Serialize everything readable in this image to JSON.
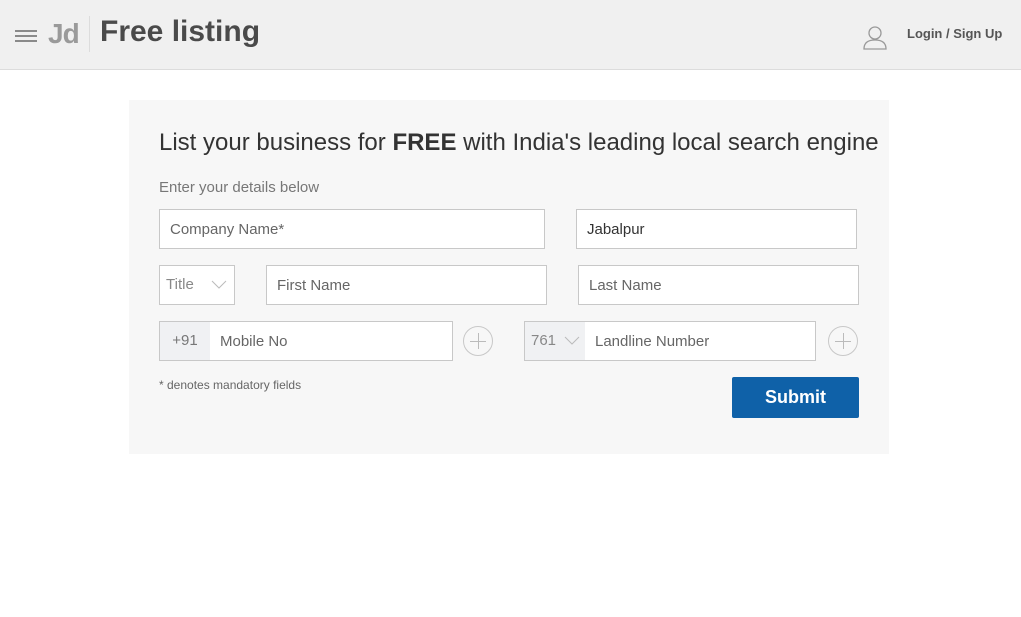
{
  "header": {
    "logo": "Jd",
    "title": "Free listing",
    "login_label": "Login / Sign Up",
    "icons": {
      "menu": "hamburger-icon",
      "user": "user-icon"
    }
  },
  "form": {
    "headline_pre": "List your business for ",
    "headline_bold": "FREE",
    "headline_post": " with India's leading local search engine",
    "subheading": "Enter your details below",
    "company_placeholder": "Company Name*",
    "city_value": "Jabalpur",
    "title_select": "Title",
    "first_name_placeholder": "First Name",
    "last_name_placeholder": "Last Name",
    "mobile_prefix": "+91",
    "mobile_placeholder": "Mobile No",
    "std_code": "761",
    "landline_placeholder": "Landline Number",
    "mandatory_note": "* denotes mandatory fields",
    "submit_label": "Submit"
  },
  "colors": {
    "primary": "#0f61a8",
    "header_bg": "#f0f0f0",
    "card_bg": "#f7f7f7"
  }
}
